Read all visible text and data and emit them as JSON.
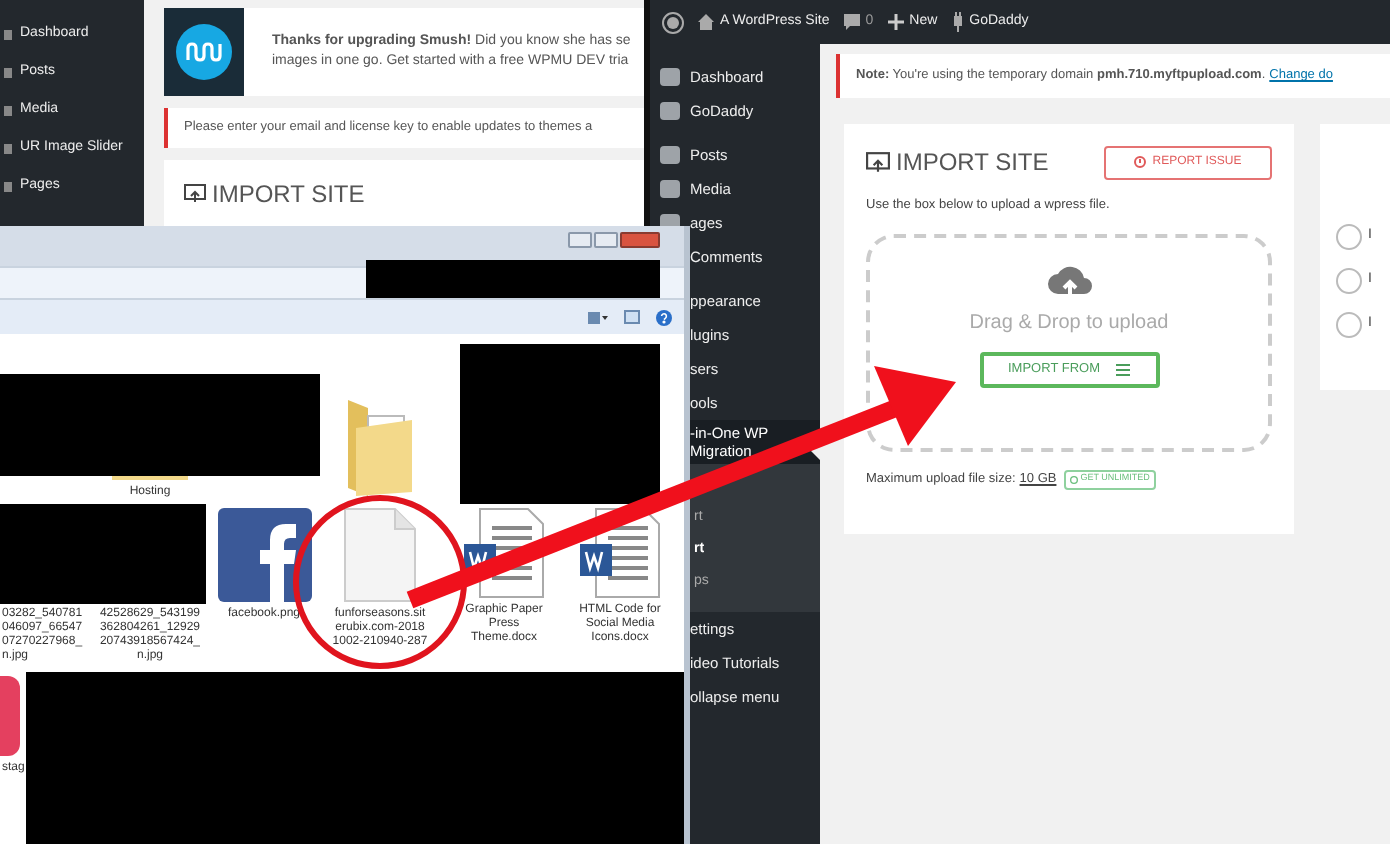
{
  "back_window": {
    "sidebar": {
      "items": [
        {
          "label": "Dashboard"
        },
        {
          "label": "Posts"
        },
        {
          "label": "Media"
        },
        {
          "label": "UR Image Slider"
        },
        {
          "label": "Pages"
        }
      ]
    },
    "smush_notice": {
      "lines": [
        "**Thanks for upgrading Smush!** Did you know she has se",
        "images in one go. Get started with a free WPMU DEV tria"
      ]
    },
    "license_notice": "Please enter your email and license key to enable updates to themes a",
    "import_title": "IMPORT SITE"
  },
  "front_window": {
    "admin_bar": {
      "site": "A WordPress Site",
      "comments": "0",
      "new": "New",
      "host": "GoDaddy"
    },
    "sidebar": {
      "items": [
        {
          "label": "Dashboard",
          "selected": false
        },
        {
          "label": "GoDaddy",
          "selected": false
        },
        {
          "label": "Posts",
          "selected": false
        },
        {
          "label": "Media",
          "selected": false
        },
        {
          "label": "ages",
          "selected": false
        },
        {
          "label": "Comments",
          "selected": false
        },
        {
          "label": "ppearance",
          "selected": false
        },
        {
          "label": "lugins",
          "selected": false
        },
        {
          "label": "sers",
          "selected": false
        },
        {
          "label": "ools",
          "selected": false
        },
        {
          "label": "-in-One WP Migration",
          "selected": true,
          "children": [
            {
              "label": "rt",
              "selected": false
            },
            {
              "label": "rt",
              "selected": true
            },
            {
              "label": "ps",
              "selected": false
            }
          ]
        },
        {
          "label": "ettings",
          "selected": false
        },
        {
          "label": "ideo Tutorials",
          "selected": false
        },
        {
          "label": "ollapse menu",
          "selected": false
        }
      ]
    },
    "notice": "**Note:** You're using the temporary domain **pmh.710.myftpupload.com**.",
    "notice_link": "Change do",
    "import": {
      "title": "IMPORT SITE",
      "report_button": "REPORT ISSUE",
      "hint": "Use the box below to upload a wpress file.",
      "drop_text": "Drag & Drop to upload",
      "import_button": "IMPORT FROM",
      "size_label": "Maximum upload file size:",
      "size_value": "10 GB",
      "unlimited_badge": "GET UNLIMITED"
    },
    "side_options": [
      {
        "label": "I",
        "selected": false
      },
      {
        "label": "I",
        "selected": false
      },
      {
        "label": "I",
        "selected": false
      }
    ]
  },
  "explorer": {
    "rows": [
      [
        {
          "kind": "empty"
        },
        {
          "kind": "folder",
          "label": "Hosting"
        },
        {
          "kind": "empty"
        },
        {
          "kind": "bigfolder"
        }
      ],
      [
        {
          "kind": "text",
          "label": "03282_540781 046097_66547 07270227968_ n.jpg"
        },
        {
          "kind": "text",
          "label": "42528629_543199 362804261_12929 20743918567424_ n.jpg"
        },
        {
          "kind": "facebook",
          "label": "facebook.png"
        },
        {
          "kind": "file",
          "label": "funforseasons.sit erubix.com-2018 1002-210940-287"
        },
        {
          "kind": "word",
          "label": "Graphic Paper Press Theme.docx"
        },
        {
          "kind": "word",
          "label": "HTML Code for Social Media Icons.docx"
        }
      ]
    ],
    "instagram_label": "stag"
  }
}
